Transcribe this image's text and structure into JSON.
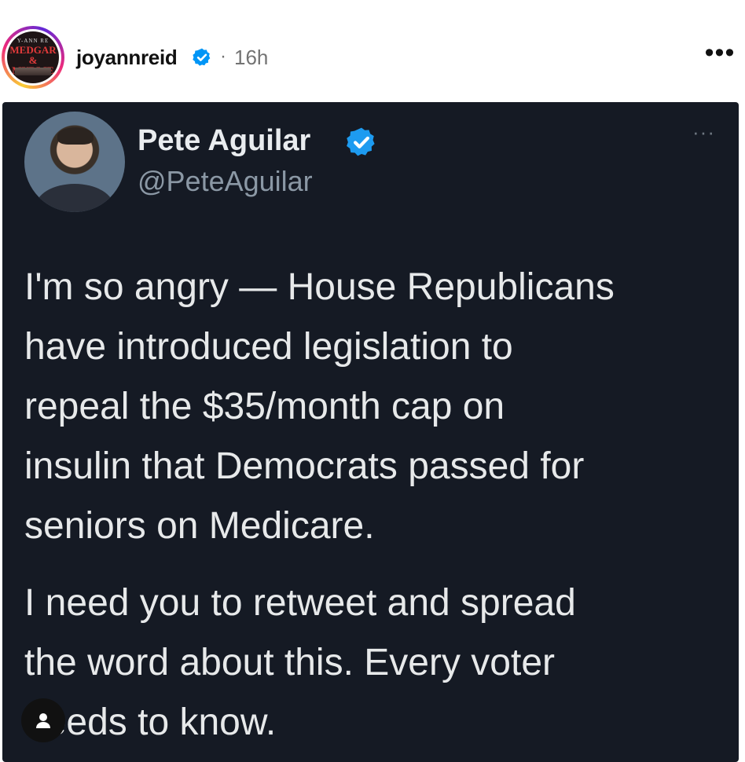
{
  "post": {
    "username": "joyannreid",
    "separator": "·",
    "time": "16h",
    "more_label": "•••",
    "avatar_book": {
      "top_text": "Y-ANN RE",
      "title_line1": "MEDGAR",
      "title_line2": "& MYRLIE"
    }
  },
  "tweet": {
    "name": "Pete Aguilar",
    "handle": "@PeteAguilar",
    "more_label": "···",
    "paragraph1_lines": [
      "I'm so angry — House Republicans",
      "have introduced legislation to",
      "repeal the $35/month cap on",
      "insulin that Democrats passed for",
      "seniors on Medicare."
    ],
    "paragraph2_lines": [
      "I need you to retweet and spread",
      "the word about this. Every voter",
      "needs to know."
    ]
  },
  "colors": {
    "verified_blue": "#0095f6",
    "tweet_background": "#151a24",
    "tweet_text": "#e7e9ea",
    "handle_gray": "#8b98a5"
  },
  "icons": {
    "verified": "verified-badge-icon",
    "tagged_user": "person-icon"
  }
}
